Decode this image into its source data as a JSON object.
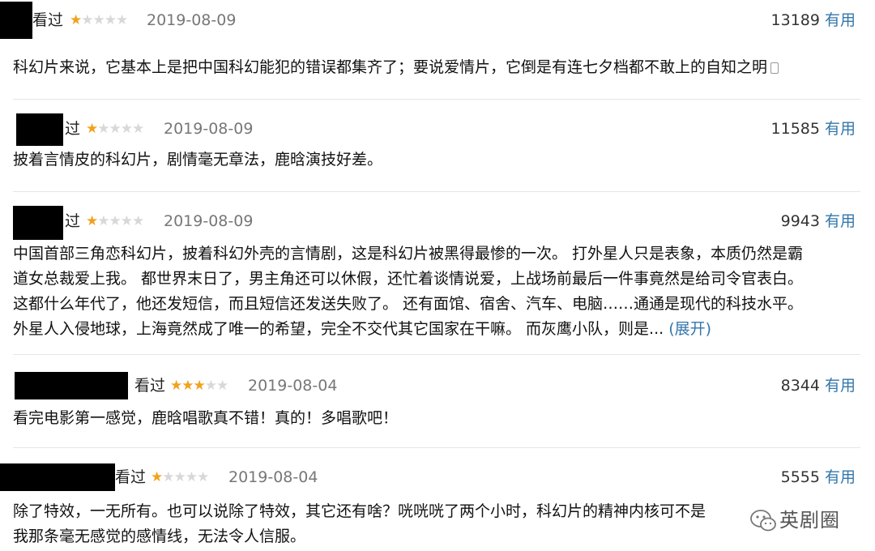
{
  "reviews": [
    {
      "status": "看过",
      "rating": 1,
      "date": "2019-08-09",
      "votes": "13189",
      "vote_label": "有用",
      "lines": [
        "科幻片来说，它基本上是把中国科幻能犯的错误都集齐了；要说爱情片，它倒是有连七夕档都不敢上的自知之明"
      ]
    },
    {
      "status": "过",
      "rating": 1,
      "date": "2019-08-09",
      "votes": "11585",
      "vote_label": "有用",
      "lines": [
        "披着言情皮的科幻片，剧情毫无章法，鹿晗演技好差。"
      ]
    },
    {
      "status": "过",
      "rating": 1,
      "date": "2019-08-09",
      "votes": "9943",
      "vote_label": "有用",
      "lines": [
        "中国首部三角恋科幻片，披着科幻外壳的言情剧，这是科幻片被黑得最惨的一次。 打外星人只是表象，本质仍然是霸",
        "道女总裁爱上我。 都世界末日了，男主角还可以休假，还忙着谈情说爱，上战场前最后一件事竟然是给司令官表白。",
        "这都什么年代了，他还发短信，而且短信还发送失败了。 还有面馆、宿舍、汽车、电脑……通通是现代的科技水平。",
        "外星人入侵地球，上海竟然成了唯一的希望，完全不交代其它国家在干嘛。 而灰鹰小队，则是..."
      ],
      "expand_label": "(展开)"
    },
    {
      "status": "看过",
      "rating": 3,
      "date": "2019-08-04",
      "votes": "8344",
      "vote_label": "有用",
      "lines": [
        "看完电影第一感觉，鹿晗唱歌真不错！真的！多唱歌吧！"
      ]
    },
    {
      "status": "看过",
      "rating": 1,
      "date": "2019-08-04",
      "votes": "5555",
      "vote_label": "有用",
      "lines": [
        "除了特效，一无所有。也可以说除了特效，其它还有啥？咣咣咣了两个小时，科幻片的精神内核可不是",
        "我那条毫无感觉的感情线，无法令人信服。"
      ]
    }
  ],
  "watermark": {
    "text": "英剧圈",
    "icon": "wechat-icon"
  },
  "colors": {
    "star_on": "#f0a21d",
    "star_off": "#d8d8d8",
    "link": "#3377aa",
    "date": "#777777"
  }
}
